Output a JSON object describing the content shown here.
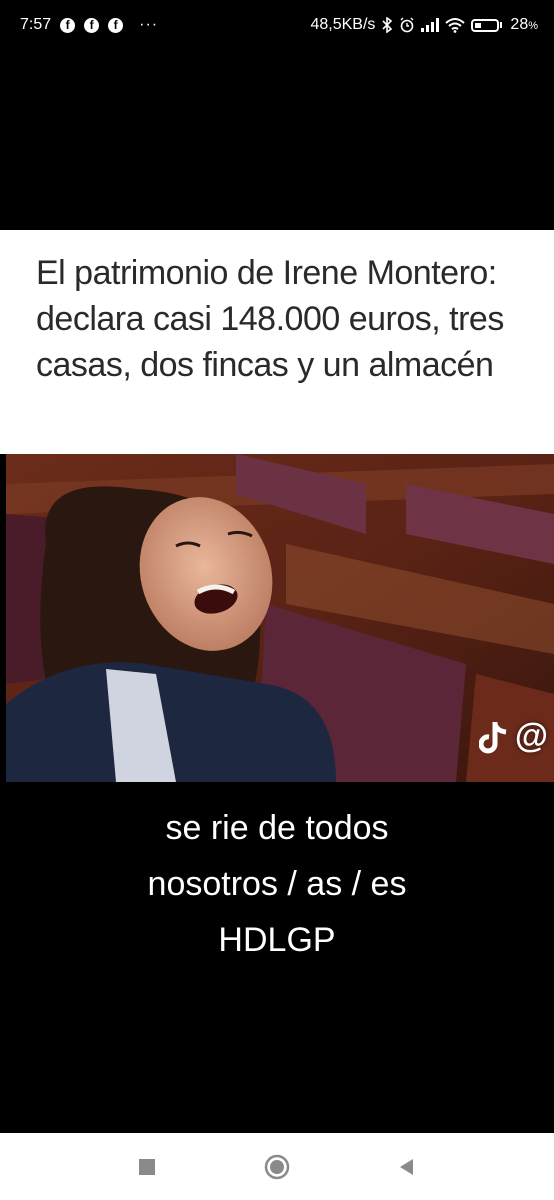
{
  "status_bar": {
    "time": "7:57",
    "more": "···",
    "net_speed": "48,5KB/s",
    "battery": "28",
    "battery_unit": "%",
    "notification_icons": [
      "facebook-icon",
      "facebook-icon",
      "facebook-icon"
    ],
    "system_icons": [
      "bluetooth-icon",
      "alarm-icon",
      "signal-icon",
      "wifi-icon",
      "battery-icon"
    ]
  },
  "post": {
    "headline": "El patrimonio de Irene Montero: declara casi 148.000 euros, tres casas, dos fincas y un almacén",
    "watermark": "@",
    "caption_lines": [
      "se rie de todos",
      "nosotros / as / es",
      "HDLGP"
    ]
  },
  "nav_bar": {
    "buttons": [
      "recents-square",
      "home-circle",
      "back-triangle"
    ]
  },
  "colors": {
    "background": "#000000",
    "card": "#ffffff",
    "headline_text": "#2a2a2a",
    "nav_icons": "#8a8a8a"
  }
}
